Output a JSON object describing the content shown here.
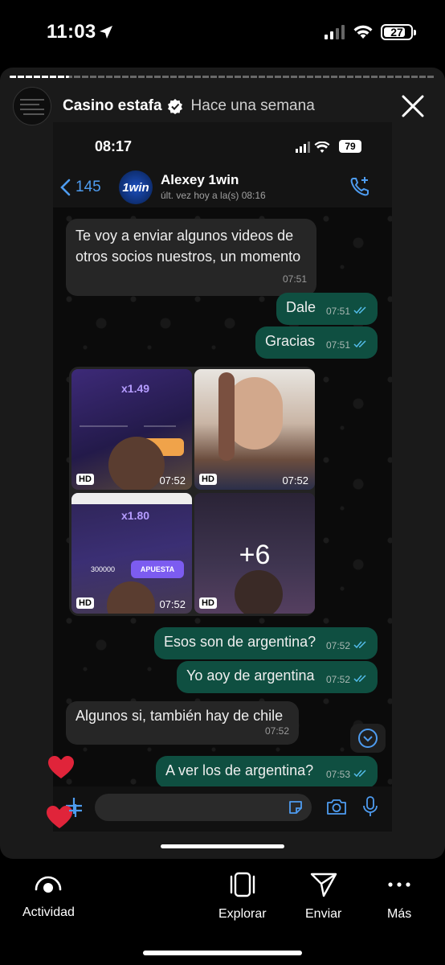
{
  "os_status": {
    "time": "11:03",
    "battery": "27"
  },
  "story": {
    "account_name": "Casino estafa",
    "posted": "Hace una semana",
    "progress": 0.14
  },
  "whatsapp": {
    "status_time": "08:17",
    "battery": "79",
    "back_count": "145",
    "contact_name": "Alexey 1win",
    "avatar_text": "1win",
    "last_seen": "últ. vez hoy a la(s) 08:16",
    "messages": [
      {
        "dir": "in",
        "text": "Te voy a enviar algunos videos de otros socios nuestros, un momento",
        "time": "07:51"
      },
      {
        "dir": "out",
        "text": "Dale",
        "time": "07:51"
      },
      {
        "dir": "out",
        "text": "Gracias",
        "time": "07:51"
      },
      {
        "dir": "out",
        "text": "Esos son de argentina?",
        "time": "07:52"
      },
      {
        "dir": "out",
        "text": "Yo aoy de argentina",
        "time": "07:52"
      },
      {
        "dir": "in",
        "text": "Algunos si, también hay de chile",
        "time": "07:52"
      },
      {
        "dir": "out",
        "text": "A ver los de argentina?",
        "time": "07:53"
      }
    ],
    "media": {
      "tiles": [
        {
          "badge": "HD",
          "time": "07:52",
          "multiplier": "x1.49"
        },
        {
          "badge": "HD",
          "time": "07:52"
        },
        {
          "badge": "HD",
          "time": "07:52",
          "multiplier": "x1.80",
          "button": "APUESTA",
          "amount": "300000"
        },
        {
          "badge": "HD",
          "more": "+6"
        }
      ]
    }
  },
  "bottom_nav": [
    {
      "label": "Actividad",
      "icon": "activity-icon"
    },
    {
      "label": "Explorar",
      "icon": "explore-icon"
    },
    {
      "label": "Enviar",
      "icon": "send-icon"
    },
    {
      "label": "Más",
      "icon": "more-icon"
    }
  ],
  "colors": {
    "incoming": "#262626",
    "outgoing": "#0f4f41",
    "accent": "#4e9cf0",
    "heart": "#e0243a"
  }
}
